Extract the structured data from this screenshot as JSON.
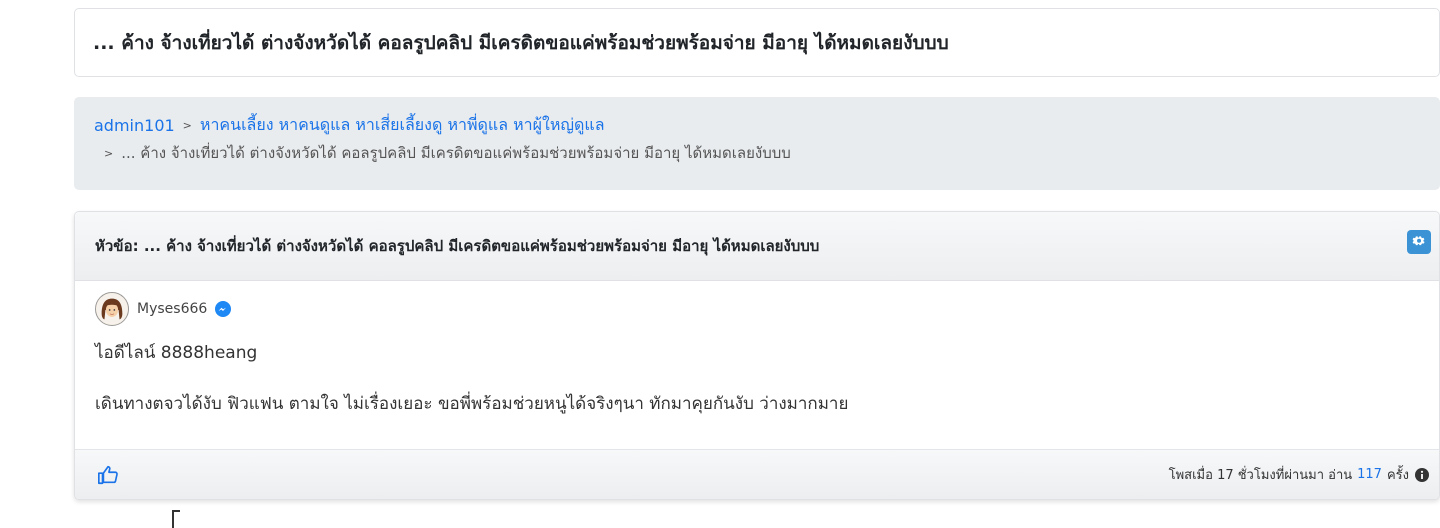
{
  "topic_title": "... ค้าง จ้างเที่ยวได้ ต่างจังหวัดได้ คอลรูปคลิป มีเครดิตขอแค่พร้อมช่วยพร้อมจ่าย มีอายุ ได้หมดเลยงับบบ",
  "breadcrumb": {
    "user": "admin101",
    "separator": ">",
    "category": "หาคนเลี้ยง หาคนดูแล หาเสี่ยเลี้ยงดู หาพี่ดูแล หาผู้ใหญ่ดูแล",
    "current": "... ค้าง จ้างเที่ยวได้ ต่างจังหวัดได้ คอลรูปคลิป มีเครดิตขอแค่พร้อมช่วยพร้อมจ่าย มีอายุ ได้หมดเลยงับบบ"
  },
  "post": {
    "header_label": "หัวข้อ:",
    "header_title": "... ค้าง จ้างเที่ยวได้ ต่างจังหวัดได้ คอลรูปคลิป มีเครดิตขอแค่พร้อมช่วยพร้อมจ่าย มีอายุ ได้หมดเลยงับบบ",
    "author": "Myses666",
    "line_id": "ไอดีไลน์ 8888heang",
    "body": "เดินทางตจวได้งับ ฟิวแฟน ตามใจ ไม่เรื่องเยอะ ขอพี่พร้อมช่วยหนูได้จริงๆนา ทักมาคุยกันงับ ว่างมากมาย",
    "footer": {
      "posted_prefix": "โพสเมื่อ 17 ชั่วโมงที่ผ่านมา อ่าน",
      "read_count": "117",
      "read_suffix": "ครั้ง"
    }
  },
  "colors": {
    "link": "#1a73e8",
    "gear": "#3b93d6",
    "crumb_bg": "#e9ecef"
  },
  "icons": [
    "gear-icon",
    "messenger-icon",
    "like-icon",
    "info-icon"
  ]
}
